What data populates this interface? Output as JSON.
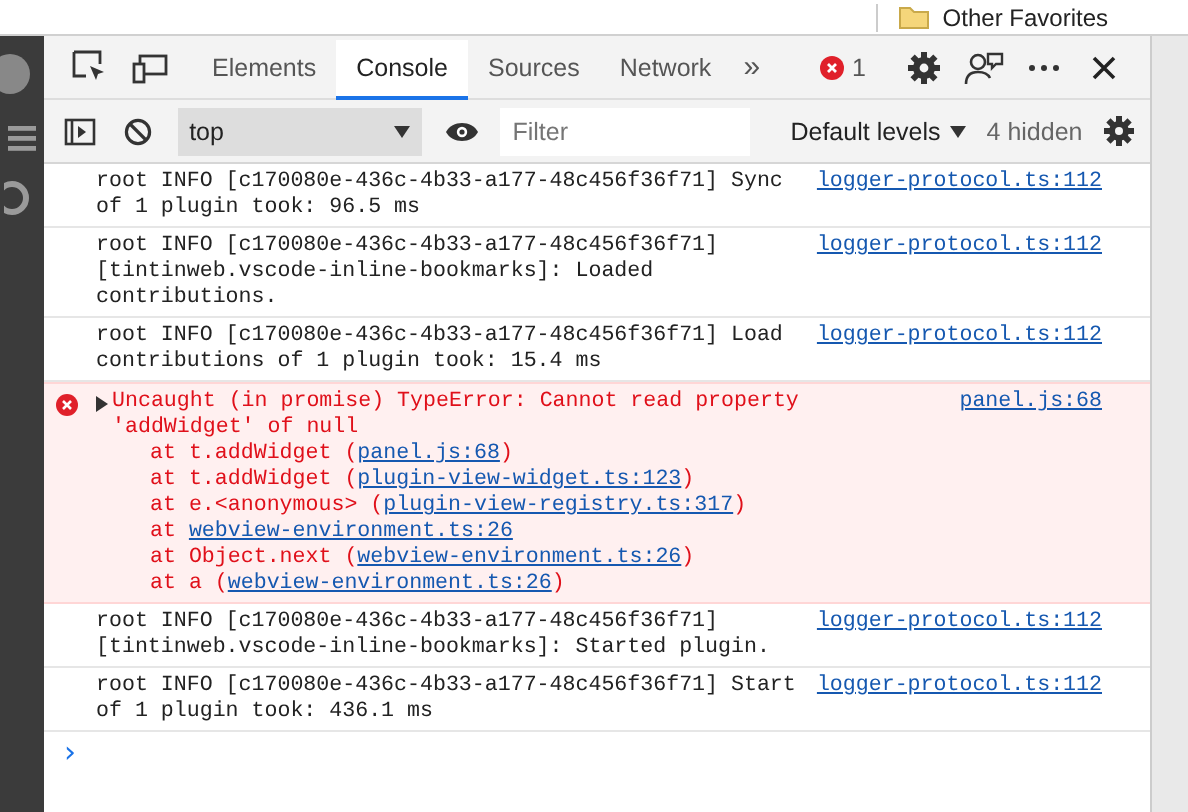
{
  "browser": {
    "bookmark": "Other Favorites"
  },
  "tabs": [
    {
      "label": "Elements",
      "selected": false
    },
    {
      "label": "Console",
      "selected": true
    },
    {
      "label": "Sources",
      "selected": false
    },
    {
      "label": "Network",
      "selected": false
    }
  ],
  "more_tabs": "»",
  "error_count": "1",
  "toolbar": {
    "context": "top",
    "filter_placeholder": "Filter",
    "levels": "Default levels",
    "hidden": "4 hidden"
  },
  "messages": [
    {
      "kind": "info",
      "text": "root INFO [c170080e-436c-4b33-a177-48c456f36f71] Sync of 1 plugin took: 96.5 ms",
      "source": "logger-protocol.ts:112"
    },
    {
      "kind": "info",
      "text": "root INFO [c170080e-436c-4b33-a177-48c456f36f71] [tintinweb.vscode-inline-bookmarks]: Loaded contributions.",
      "source": "logger-protocol.ts:112"
    },
    {
      "kind": "info",
      "text": "root INFO [c170080e-436c-4b33-a177-48c456f36f71] Load contributions of 1 plugin took: 15.4 ms",
      "source": "logger-protocol.ts:112"
    },
    {
      "kind": "error",
      "expanded": false,
      "text": "Uncaught (in promise) TypeError: Cannot read property 'addWidget' of null",
      "source": "panel.js:68",
      "stack": [
        {
          "before": "at t.addWidget (",
          "link": "panel.js:68",
          "after": ")"
        },
        {
          "before": "at t.addWidget (",
          "link": "plugin-view-widget.ts:123",
          "after": ")"
        },
        {
          "before": "at e.<anonymous> (",
          "link": "plugin-view-registry.ts:317",
          "after": ")"
        },
        {
          "before": "at ",
          "link": "webview-environment.ts:26"
        },
        {
          "before": "at Object.next (",
          "link": "webview-environment.ts:26",
          "after": ")"
        },
        {
          "before": "at a (",
          "link": "webview-environment.ts:26",
          "after": ")"
        }
      ]
    },
    {
      "kind": "info",
      "text": "root INFO [c170080e-436c-4b33-a177-48c456f36f71] [tintinweb.vscode-inline-bookmarks]: Started plugin.",
      "source": "logger-protocol.ts:112"
    },
    {
      "kind": "info",
      "text": "root INFO [c170080e-436c-4b33-a177-48c456f36f71] Start of 1 plugin took: 436.1 ms",
      "source": "logger-protocol.ts:112"
    }
  ],
  "prompt": "›"
}
